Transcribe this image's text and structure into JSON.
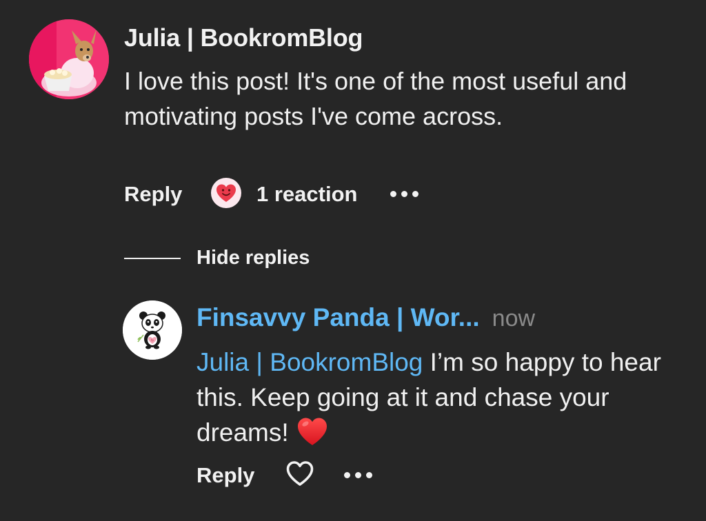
{
  "comment": {
    "author": "Julia | BookromBlog",
    "text": "I love this post! It's one of the most useful and motivating posts I've come across.",
    "actions": {
      "reply_label": "Reply",
      "reaction_count_label": "1 reaction",
      "reaction_icon": "smiling-heart-face-icon",
      "more_icon": "more-dots-icon"
    }
  },
  "thread": {
    "hide_replies_label": "Hide replies"
  },
  "reply": {
    "author": "Finsavvy Panda | Wor...",
    "time": "now",
    "mention": "Julia | BookromBlog",
    "text": " I’m so happy to hear this. Keep going at it and chase your dreams!",
    "emoji": "red-heart-emoji",
    "actions": {
      "reply_label": "Reply",
      "like_icon": "heart-outline-icon",
      "more_icon": "more-dots-icon"
    }
  },
  "colors": {
    "background": "#262626",
    "link_blue": "#5fb8f5",
    "muted_gray": "#8a8a8a",
    "text": "#f2f2f2",
    "heart_red": "#e8222f"
  }
}
